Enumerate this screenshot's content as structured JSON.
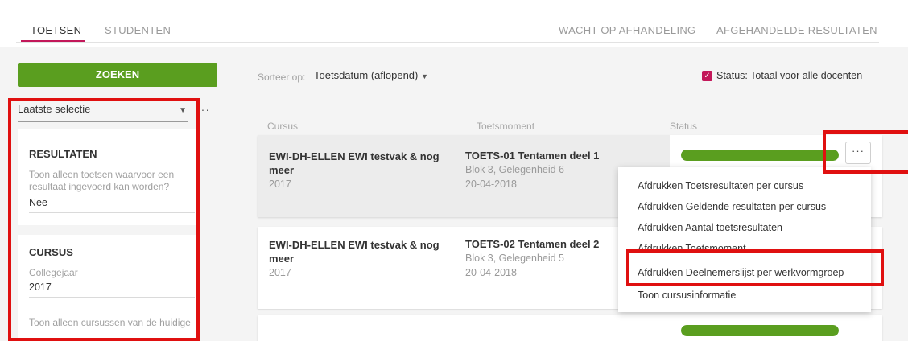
{
  "tabs": {
    "toetsen": "TOETSEN",
    "studenten": "STUDENTEN",
    "wacht": "WACHT OP AFHANDELING",
    "afgehandelde": "AFGEHANDELDE RESULTATEN"
  },
  "search_button": "ZOEKEN",
  "selection": {
    "value": "Laatste selectie",
    "more": "···"
  },
  "filters": {
    "resultaten": {
      "heading": "RESULTATEN",
      "description": "Toon alleen toetsen waarvoor een resultaat ingevoerd kan worden?",
      "value": "Nee"
    },
    "cursus": {
      "heading": "CURSUS",
      "label": "Collegejaar",
      "value": "2017",
      "description": "Toon alleen cursussen van de huidige"
    }
  },
  "sort": {
    "label": "Sorteer op:",
    "value": "Toetsdatum (aflopend)"
  },
  "status_filter": {
    "label": "Status: Totaal voor alle docenten",
    "checked": true
  },
  "columns": {
    "cursus": "Cursus",
    "toetsmoment": "Toetsmoment",
    "status": "Status"
  },
  "rows": [
    {
      "course": "EWI-DH-ELLEN  EWI testvak & nog meer",
      "year": "2017",
      "test": "TOETS-01  Tentamen deel 1",
      "block": "Blok 3, Gelegenheid 6",
      "date": "20-04-2018",
      "progress": 1.0
    },
    {
      "course": "EWI-DH-ELLEN  EWI testvak & nog meer",
      "year": "2017",
      "test": "TOETS-02  Tentamen deel 2",
      "block": "Blok 3, Gelegenheid 5",
      "date": "20-04-2018",
      "progress": 1.0
    }
  ],
  "more_button": "···",
  "menu": {
    "items": [
      "Afdrukken Toetsresultaten per cursus",
      "Afdrukken Geldende resultaten per cursus",
      "Afdrukken Aantal toetsresultaten",
      "Afdrukken Toetsmoment",
      "Afdrukken Deelnemerslijst per werkvormgroep",
      "Toon cursusinformatie"
    ]
  },
  "colors": {
    "accent": "#c3185a",
    "green": "#5a9e1f",
    "highlight": "#e01010"
  }
}
